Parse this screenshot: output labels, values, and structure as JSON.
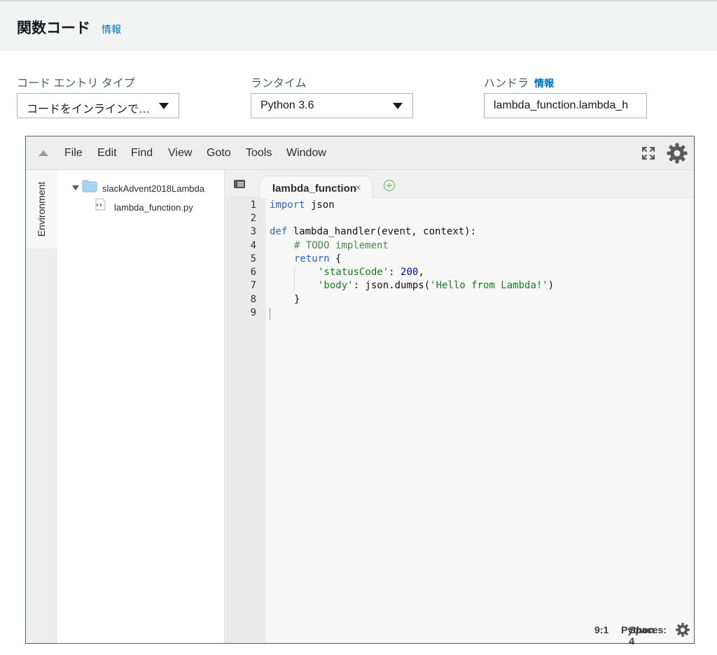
{
  "header": {
    "title": "関数コード",
    "info": "情報"
  },
  "fields": {
    "code_entry": {
      "label": "コード エントリ タイプ",
      "value": "コードをインラインで…"
    },
    "runtime": {
      "label": "ランタイム",
      "value": "Python 3.6"
    },
    "handler": {
      "label": "ハンドラ",
      "info": "情報",
      "value": "lambda_function.lambda_h"
    }
  },
  "ide": {
    "menu": [
      "File",
      "Edit",
      "Find",
      "View",
      "Goto",
      "Tools",
      "Window"
    ],
    "environment_tab": "Environment",
    "tree": {
      "folder": "slackAdvent2018Lambda",
      "file": "lambda_function.py"
    },
    "tab": {
      "title": "lambda_function",
      "close": "×"
    },
    "line_numbers": [
      "1",
      "2",
      "3",
      "4",
      "5",
      "6",
      "7",
      "8",
      "9"
    ],
    "code": {
      "l1_kw": "import",
      "l1_rest": " json",
      "l3_kw": "def",
      "l3_rest": " lambda_handler(event, context):",
      "l4_comment": "# TODO implement",
      "l5_kw": "return",
      "l5_rest": " {",
      "l6_str": "'statusCode'",
      "l6_mid": ": ",
      "l6_num": "200",
      "l6_end": ",",
      "l7_str": "'body'",
      "l7_mid": ": json.dumps(",
      "l7_str2": "'Hello from Lambda!'",
      "l7_end": ")",
      "l8": "}"
    },
    "status": {
      "position": "9:1",
      "language": "Python",
      "spaces": "Spaces: 4"
    },
    "icons": {
      "collapse": "triangle-up-icon",
      "fullscreen": "fullscreen-icon",
      "settings": "gear-icon",
      "folder": "folder-icon",
      "file": "python-file-icon",
      "tab_menu": "tab-menu-icon",
      "add_tab": "add-tab-icon"
    }
  }
}
